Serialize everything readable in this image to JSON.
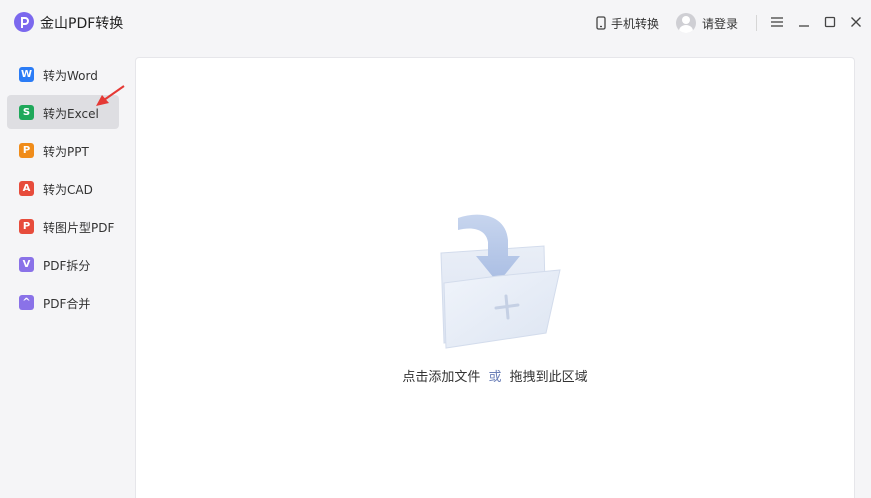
{
  "app": {
    "title": "金山PDF转换",
    "logo_icon": "pdf-logo-icon"
  },
  "header": {
    "mobile_label": "手机转换",
    "login_label": "请登录"
  },
  "sidebar": {
    "items": [
      {
        "label": "转为Word",
        "icon": "word-icon",
        "color": "#2b7cf6",
        "glyph": "W",
        "active": false
      },
      {
        "label": "转为Excel",
        "icon": "excel-icon",
        "color": "#1fa85a",
        "glyph": "S",
        "active": true
      },
      {
        "label": "转为PPT",
        "icon": "ppt-icon",
        "color": "#f08c1a",
        "glyph": "P",
        "active": false
      },
      {
        "label": "转为CAD",
        "icon": "cad-icon",
        "color": "#e74c3c",
        "glyph": "A",
        "active": false
      },
      {
        "label": "转图片型PDF",
        "icon": "image-pdf-icon",
        "color": "#e74c3c",
        "glyph": "P",
        "active": false
      },
      {
        "label": "PDF拆分",
        "icon": "split-icon",
        "color": "#8a72e8",
        "glyph": "V",
        "active": false
      },
      {
        "label": "PDF合并",
        "icon": "merge-icon",
        "color": "#8a72e8",
        "glyph": "^",
        "active": false
      }
    ]
  },
  "main": {
    "drop_text_pre": "点击添加文件",
    "drop_text_or": "或",
    "drop_text_post": "拖拽到此区域"
  },
  "colors": {
    "accent": "#7b68ee",
    "active_bg": "#dedee2",
    "annotation": "#e53935"
  }
}
